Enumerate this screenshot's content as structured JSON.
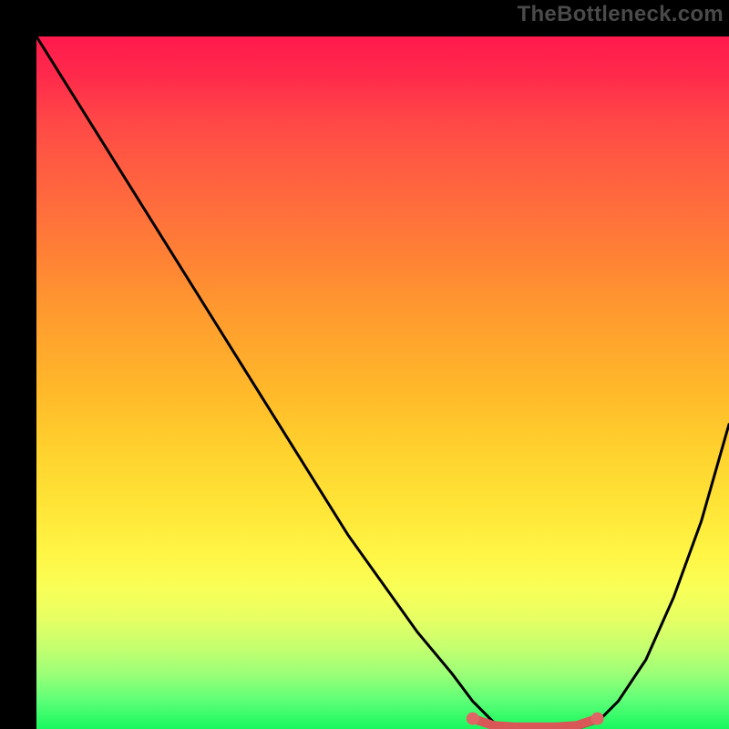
{
  "watermark": "TheBottleneck.com",
  "colors": {
    "background": "#000000",
    "curve_stroke": "#000000",
    "marker_fill": "#e06666",
    "marker_stroke": "#d95757"
  },
  "chart_data": {
    "type": "line",
    "title": "",
    "xlabel": "",
    "ylabel": "",
    "xlim": [
      0,
      100
    ],
    "ylim": [
      0,
      100
    ],
    "grid": false,
    "legend": false,
    "series": [
      {
        "name": "bottleneck-curve",
        "x": [
          0,
          5,
          10,
          15,
          20,
          25,
          30,
          35,
          40,
          45,
          50,
          55,
          60,
          63,
          66,
          69,
          72,
          75,
          78,
          81,
          84,
          88,
          92,
          96,
          100
        ],
        "y": [
          100,
          92,
          84,
          76,
          68,
          60,
          52,
          44,
          36,
          28,
          21,
          14,
          8,
          4,
          1,
          0,
          0,
          0,
          0,
          1,
          4,
          10,
          19,
          30,
          44
        ]
      }
    ],
    "markers": {
      "name": "optimal-range",
      "x": [
        63,
        66,
        69,
        72,
        75,
        78,
        81
      ],
      "y": [
        1.5,
        0.5,
        0.3,
        0.3,
        0.3,
        0.5,
        1.5
      ]
    },
    "gradient_stops": [
      {
        "pos": 0,
        "color": "#ff1a4d"
      },
      {
        "pos": 25,
        "color": "#ff6e3c"
      },
      {
        "pos": 50,
        "color": "#ffbb2a"
      },
      {
        "pos": 75,
        "color": "#fff646"
      },
      {
        "pos": 90,
        "color": "#b3ff72"
      },
      {
        "pos": 100,
        "color": "#18f85e"
      }
    ]
  }
}
